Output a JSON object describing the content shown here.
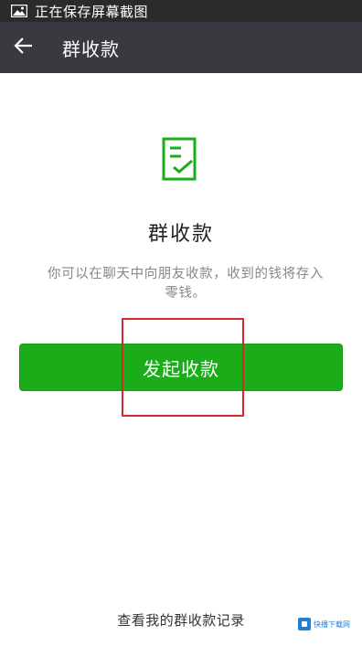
{
  "status_bar": {
    "text": "正在保存屏幕截图",
    "icon": "image-icon"
  },
  "app_bar": {
    "title": "群收款",
    "back_icon": "back-arrow-icon"
  },
  "main": {
    "heading": "群收款",
    "description": "你可以在聊天中向朋友收款，收到的钱将存入零钱。",
    "primary_button_label": "发起收款",
    "records_link": "查看我的群收款记录",
    "icon": "document-check-icon"
  },
  "watermark": {
    "text": "快播下载网"
  },
  "colors": {
    "status_bar_bg": "#2b2b2b",
    "app_bar_bg": "#393a3f",
    "accent_green": "#1aad19",
    "highlight_red": "#d42a2a"
  }
}
